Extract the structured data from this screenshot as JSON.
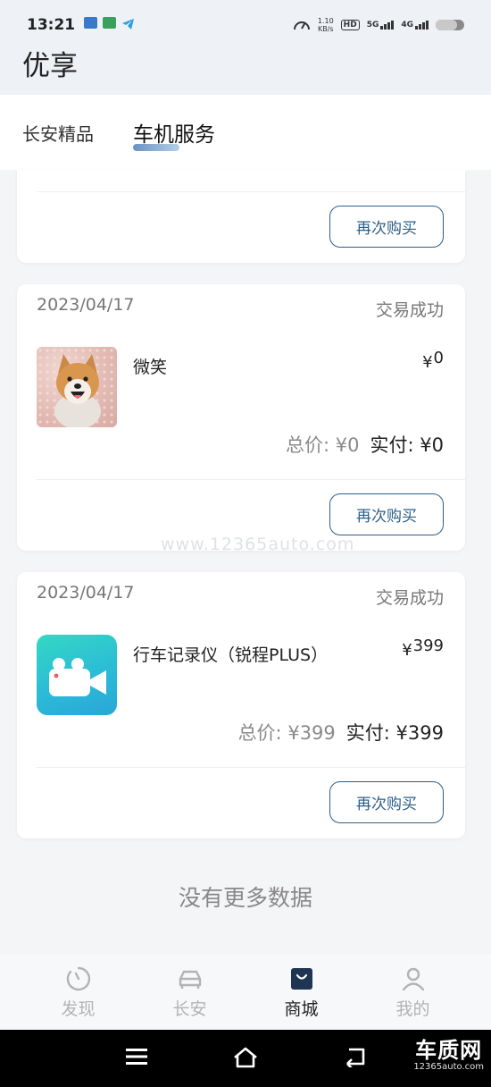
{
  "status_bar": {
    "time": "13:21",
    "net_speed_value": "1.10",
    "net_speed_unit": "KB/s",
    "hd_label": "HD",
    "sim1_label": "5G",
    "sim2_label": "4G",
    "battery_percent": 75
  },
  "header": {
    "title": "优享"
  },
  "tabs": [
    {
      "label": "长安精品",
      "active": false
    },
    {
      "label": "车机服务",
      "active": true
    }
  ],
  "orders": [
    {
      "rebuy_label": "再次购买"
    },
    {
      "date": "2023/04/17",
      "status": "交易成功",
      "product_name": "微笑",
      "currency": "¥",
      "unit_price": "0",
      "total_label": "总价:",
      "total_value": "¥0",
      "paid_label": "实付:",
      "paid_value": "¥0",
      "rebuy_label": "再次购买"
    },
    {
      "date": "2023/04/17",
      "status": "交易成功",
      "product_name": "行车记录仪（锐程PLUS）",
      "currency": "¥",
      "unit_price": "399",
      "total_label": "总价:",
      "total_value": "¥399",
      "paid_label": "实付:",
      "paid_value": "¥399",
      "rebuy_label": "再次购买"
    }
  ],
  "no_more_text": "没有更多数据",
  "watermark": "www.12365auto.com",
  "bottom_nav": [
    {
      "label": "发现",
      "icon": "discover-icon",
      "active": false
    },
    {
      "label": "长安",
      "icon": "car-icon",
      "active": false
    },
    {
      "label": "商城",
      "icon": "shopping-bag-icon",
      "active": true
    },
    {
      "label": "我的",
      "icon": "profile-icon",
      "active": false
    }
  ],
  "brand": {
    "name": "车质网",
    "url": "12365auto.com"
  }
}
